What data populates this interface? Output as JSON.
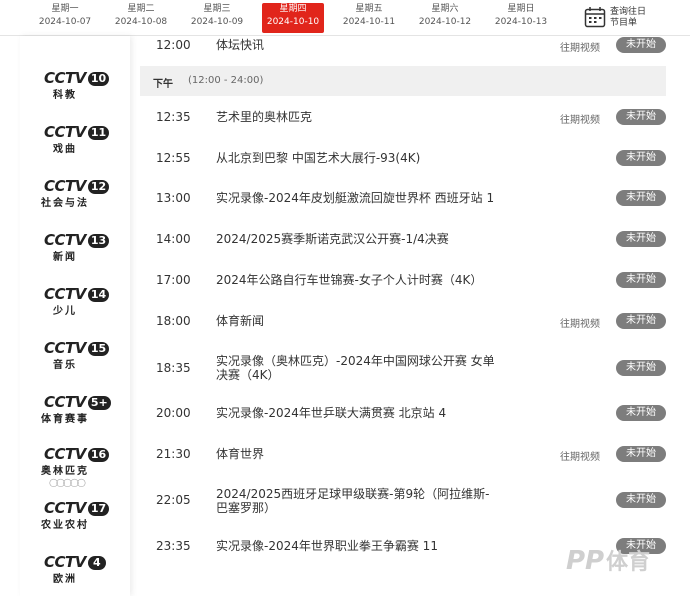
{
  "week": [
    {
      "weekday": "星期一",
      "date": "2024-10-07",
      "active": false
    },
    {
      "weekday": "星期二",
      "date": "2024-10-08",
      "active": false
    },
    {
      "weekday": "星期三",
      "date": "2024-10-09",
      "active": false
    },
    {
      "weekday": "星期四",
      "date": "2024-10-10",
      "active": true
    },
    {
      "weekday": "星期五",
      "date": "2024-10-11",
      "active": false
    },
    {
      "weekday": "星期六",
      "date": "2024-10-12",
      "active": false
    },
    {
      "weekday": "星期日",
      "date": "2024-10-13",
      "active": false
    }
  ],
  "history_link": {
    "line1": "查询往日",
    "line2": "节目单",
    "icon": "calendar-icon"
  },
  "channels": [
    {
      "logo": "CCTV",
      "number": "10",
      "name": "科教"
    },
    {
      "logo": "CCTV",
      "number": "11",
      "name": "戏曲"
    },
    {
      "logo": "CCTV",
      "number": "12",
      "name": "社会与法"
    },
    {
      "logo": "CCTV",
      "number": "13",
      "name": "新闻"
    },
    {
      "logo": "CCTV",
      "number": "14",
      "name": "少儿"
    },
    {
      "logo": "CCTV",
      "number": "15",
      "name": "音乐"
    },
    {
      "logo": "CCTV",
      "number": "5+",
      "name": "体育赛事"
    },
    {
      "logo": "CCTV",
      "number": "16",
      "name": "奥林匹克"
    },
    {
      "logo": "CCTV",
      "number": "17",
      "name": "农业农村"
    },
    {
      "logo": "CCTV",
      "number": "4",
      "name": "欧洲"
    }
  ],
  "section": {
    "label": "下午",
    "range": "(12:00 - 24:00)"
  },
  "programs": [
    {
      "time": "12:00",
      "title": "体坛快讯",
      "replay": "往期视频",
      "status": "未开始"
    },
    {
      "time": "12:35",
      "title": "艺术里的奥林匹克",
      "replay": "往期视频",
      "status": "未开始"
    },
    {
      "time": "12:55",
      "title": "从北京到巴黎 中国艺术大展行-93(4K)",
      "replay": "",
      "status": "未开始"
    },
    {
      "time": "13:00",
      "title": "实况录像-2024年皮划艇激流回旋世界杯 西班牙站 1",
      "replay": "",
      "status": "未开始"
    },
    {
      "time": "14:00",
      "title": "2024/2025赛季斯诺克武汉公开赛-1/4决赛",
      "replay": "",
      "status": "未开始"
    },
    {
      "time": "17:00",
      "title": "2024年公路自行车世锦赛-女子个人计时赛（4K）",
      "replay": "",
      "status": "未开始"
    },
    {
      "time": "18:00",
      "title": "体育新闻",
      "replay": "往期视频",
      "status": "未开始"
    },
    {
      "time": "18:35",
      "title": "实况录像（奥林匹克）-2024年中国网球公开赛 女单决赛（4K）",
      "replay": "",
      "status": "未开始"
    },
    {
      "time": "20:00",
      "title": "实况录像-2024年世乒联大满贯赛 北京站 4",
      "replay": "",
      "status": "未开始"
    },
    {
      "time": "21:30",
      "title": "体育世界",
      "replay": "往期视频",
      "status": "未开始"
    },
    {
      "time": "22:05",
      "title": "2024/2025西班牙足球甲级联赛-第9轮（阿拉维斯-巴塞罗那）",
      "replay": "",
      "status": "未开始"
    },
    {
      "time": "23:35",
      "title": "实况录像-2024年世界职业拳王争霸赛 11",
      "replay": "",
      "status": "未开始"
    }
  ],
  "watermark": {
    "latin": "PP",
    "cn": "体育"
  }
}
